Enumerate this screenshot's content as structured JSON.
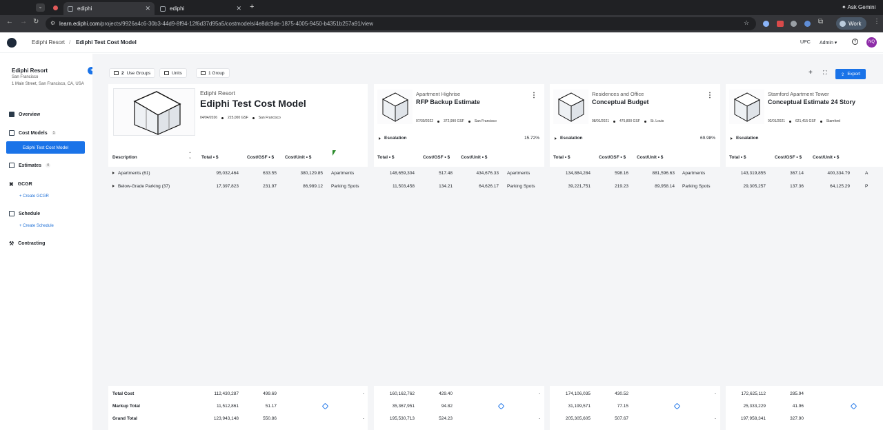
{
  "browser": {
    "tabs": [
      {
        "title": "ediphi"
      },
      {
        "title": "ediphi"
      }
    ],
    "url_host": "learn.ediphi.com",
    "url_path": "/projects/9926a4c6-30b3-44d9-8f94-12f6d37d95a5/costmodels/4e8dc9de-1875-4005-9450-b4351b257a91/view",
    "ask_gemini": "Ask Gemini",
    "profile": "Work"
  },
  "header": {
    "breadcrumb_project": "Ediphi Resort",
    "breadcrumb_sep": "/",
    "page_title": "Ediphi Test Cost Model",
    "upc": "UPC",
    "admin": "Admin",
    "avatar": "NQ"
  },
  "sidebar": {
    "project_name": "Ediphi Resort",
    "city": "San Francisco",
    "address": "1 Main Street, San Francisco, CA, USA",
    "items": [
      {
        "label": "Overview"
      },
      {
        "label": "Cost Models",
        "badge": "1"
      },
      {
        "label": "Estimates",
        "badge": "4"
      },
      {
        "label": "GCGR"
      },
      {
        "label": "Schedule"
      },
      {
        "label": "Contracting"
      }
    ],
    "active_item": "Ediphi Test Cost Model",
    "create_gcgr": "+ Create GCGR",
    "create_schedule": "+ Create Schedule"
  },
  "toolbar": {
    "use_groups_count": "2",
    "use_groups_label": "Use Groups",
    "units_label": "Units",
    "group_label": "1 Group",
    "export_label": "Export"
  },
  "main_card": {
    "project": "Ediphi Resort",
    "title": "Ediphi Test Cost Model",
    "date": "04/04/2026",
    "gsf": "225,000 GSF",
    "city": "San Francisco"
  },
  "estimates": [
    {
      "project": "Apartment Highrise",
      "title": "RFP Backup Estimate",
      "date": "07/30/2022",
      "gsf": "372,990 GSF",
      "city": "San Francisco",
      "escalation": "15.72%"
    },
    {
      "project": "Residences and Office",
      "title": "Conceptual Budget",
      "date": "08/01/2021",
      "gsf": "475,800 GSF",
      "city": "St. Louis",
      "escalation": "69.98%"
    },
    {
      "project": "Stamford Apartment Tower",
      "title": "Conceptual Estimate 24 Story",
      "date": "02/01/2021",
      "gsf": "621,415 GSF",
      "city": "Stamford",
      "escalation": ""
    }
  ],
  "escalation_label": "Escalation",
  "columns": {
    "description": "Description",
    "total": "Total • $",
    "cost_gsf": "Cost/GSF • $",
    "cost_unit": "Cost/Unit • $"
  },
  "rows": [
    {
      "description": "Apartments (61)",
      "main": {
        "total": "95,032,464",
        "gsf": "633.55",
        "unit": "380,129.85",
        "unit_label": "Apartments"
      },
      "est": [
        {
          "total": "148,659,304",
          "gsf": "517.48",
          "unit": "434,676.33",
          "unit_label": "Apartments"
        },
        {
          "total": "134,884,284",
          "gsf": "598.16",
          "unit": "881,596.63",
          "unit_label": "Apartments"
        },
        {
          "total": "143,319,855",
          "gsf": "367.14",
          "unit": "400,334.79",
          "unit_label": "A"
        }
      ]
    },
    {
      "description": "Below-Grade Parking (37)",
      "main": {
        "total": "17,397,823",
        "gsf": "231.97",
        "unit": "86,989.12",
        "unit_label": "Parking Spots"
      },
      "est": [
        {
          "total": "11,503,458",
          "gsf": "134.21",
          "unit": "64,626.17",
          "unit_label": "Parking Spots"
        },
        {
          "total": "39,221,751",
          "gsf": "219.23",
          "unit": "89,958.14",
          "unit_label": "Parking Spots"
        },
        {
          "total": "29,305,257",
          "gsf": "137.36",
          "unit": "64,125.29",
          "unit_label": "P"
        }
      ]
    }
  ],
  "totals": [
    {
      "label": "Total Cost",
      "main": [
        "112,430,287",
        "499.69",
        "-"
      ],
      "est": [
        [
          "160,162,762",
          "429.40",
          "-"
        ],
        [
          "174,106,035",
          "430.52",
          "-"
        ],
        [
          "172,625,112",
          "285.94",
          ""
        ]
      ]
    },
    {
      "label": "Markup Total",
      "main": [
        "11,512,861",
        "51.17",
        ""
      ],
      "est": [
        [
          "35,367,951",
          "94.82",
          ""
        ],
        [
          "31,199,571",
          "77.15",
          ""
        ],
        [
          "25,333,229",
          "41.96",
          ""
        ]
      ]
    },
    {
      "label": "Grand Total",
      "main": [
        "123,943,148",
        "550.86",
        "-"
      ],
      "est": [
        [
          "195,530,713",
          "524.23",
          "-"
        ],
        [
          "205,305,605",
          "507.67",
          "-"
        ],
        [
          "197,958,341",
          "327.90",
          ""
        ]
      ]
    }
  ]
}
